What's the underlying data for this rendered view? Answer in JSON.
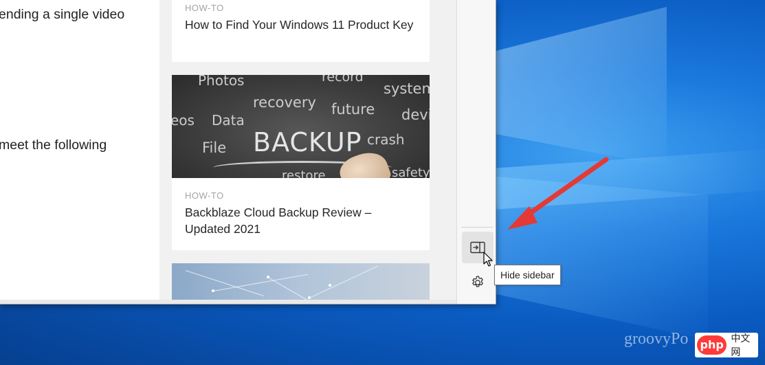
{
  "article": {
    "line1": "ending a single video",
    "line2": "meet the following"
  },
  "feed": {
    "cards": [
      {
        "tag": "HOW-TO",
        "title": "How to Find Your Windows 11 Product Key"
      },
      {
        "tag": "HOW-TO",
        "title": "Backblaze Cloud Backup Review – Updated 2021",
        "image_words": [
          "Photos",
          "record",
          "system",
          "recovery",
          "future",
          "device",
          "eos",
          "Data",
          "BACKUP",
          "crash",
          "File",
          "restore",
          "safety"
        ]
      },
      {
        "tag": "",
        "title": ""
      }
    ]
  },
  "sidebar": {
    "hide_button_icon": "sidebar-collapse-icon",
    "settings_button_icon": "gear-icon",
    "tooltip": "Hide sidebar"
  },
  "watermark": {
    "text": "groovyPo",
    "badge_logo": "php",
    "badge_text": "中文网"
  },
  "colors": {
    "annotation_arrow": "#e53935",
    "desktop": "#0a5fc4"
  }
}
